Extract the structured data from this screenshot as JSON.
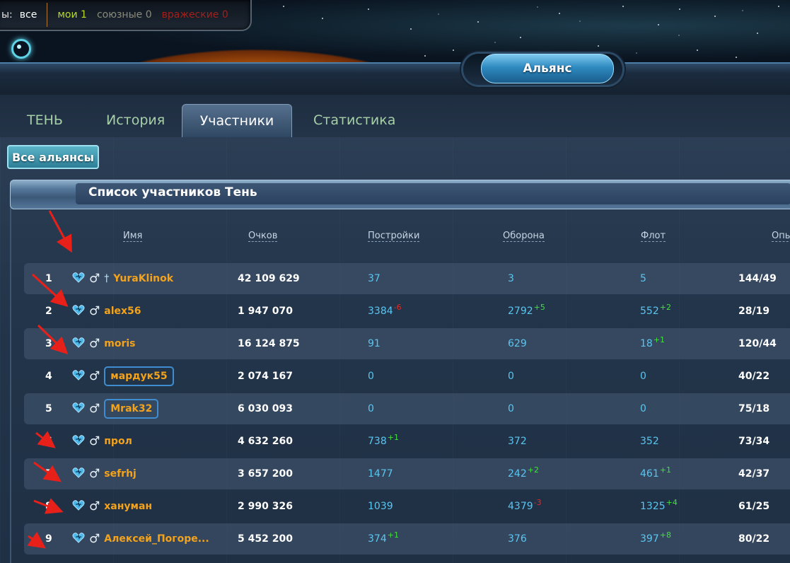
{
  "filter_bar": {
    "label": "ы:",
    "all": "все",
    "mine": "мои 1",
    "allied": "союзные 0",
    "enemy": "вражеские 0"
  },
  "header": {
    "title": "Альянс"
  },
  "tabs": [
    {
      "label": "ТЕНЬ"
    },
    {
      "label": "История"
    },
    {
      "label": "Участники"
    },
    {
      "label": "Статистика"
    }
  ],
  "all_alliances_button": "Все альянсы",
  "panel_title": "Список участников Тень",
  "columns": {
    "name": "Имя",
    "points": "Очков",
    "buildings": "Постройки",
    "defense": "Оборона",
    "fleet": "Флот",
    "experience": "Опы"
  },
  "members": [
    {
      "rank": "1",
      "name": "YuraKlinok",
      "points": "42 109 629",
      "buildings": "37",
      "buildings_delta": "",
      "defense": "3",
      "defense_delta": "",
      "fleet": "5",
      "fleet_delta": "",
      "exp": "144/49"
    },
    {
      "rank": "2",
      "name": "alex56",
      "points": "1 947 070",
      "buildings": "3384",
      "buildings_delta": "-6",
      "defense": "2792",
      "defense_delta": "+5",
      "fleet": "552",
      "fleet_delta": "+2",
      "exp": "28/19"
    },
    {
      "rank": "3",
      "name": "moris",
      "points": "16 124 875",
      "buildings": "91",
      "buildings_delta": "",
      "defense": "629",
      "defense_delta": "",
      "fleet": "18",
      "fleet_delta": "+1",
      "exp": "120/44"
    },
    {
      "rank": "4",
      "name": "мардук55",
      "points": "2 074 167",
      "buildings": "0",
      "buildings_delta": "",
      "defense": "0",
      "defense_delta": "",
      "fleet": "0",
      "fleet_delta": "",
      "exp": "40/22"
    },
    {
      "rank": "5",
      "name": "Mrak32",
      "points": "6 030 093",
      "buildings": "0",
      "buildings_delta": "",
      "defense": "0",
      "defense_delta": "",
      "fleet": "0",
      "fleet_delta": "",
      "exp": "75/18"
    },
    {
      "rank": "6",
      "name": "прол",
      "points": "4 632 260",
      "buildings": "738",
      "buildings_delta": "+1",
      "defense": "372",
      "defense_delta": "",
      "fleet": "352",
      "fleet_delta": "",
      "exp": "73/34"
    },
    {
      "rank": "7",
      "name": "sefrhj",
      "points": "3 657 200",
      "buildings": "1477",
      "buildings_delta": "",
      "defense": "242",
      "defense_delta": "+2",
      "fleet": "461",
      "fleet_delta": "+1",
      "exp": "42/37"
    },
    {
      "rank": "8",
      "name": "хануман",
      "points": "2 990 326",
      "buildings": "1039",
      "buildings_delta": "",
      "defense": "4379",
      "defense_delta": "-3",
      "fleet": "1325",
      "fleet_delta": "+4",
      "exp": "61/25"
    },
    {
      "rank": "9",
      "name": "Алексей_Погоре...",
      "points": "5 452 200",
      "buildings": "374",
      "buildings_delta": "+1",
      "defense": "376",
      "defense_delta": "",
      "fleet": "397",
      "fleet_delta": "+8",
      "exp": "80/22"
    }
  ],
  "icons": {
    "status": "heart-icon",
    "gender": "male-icon",
    "leader": "sword-icon"
  },
  "colors": {
    "name": "#f3a21a",
    "number": "#5bc5ef",
    "delta_up": "#41e23a",
    "delta_down": "#e52a22",
    "annotation_arrow": "#e8201a"
  }
}
